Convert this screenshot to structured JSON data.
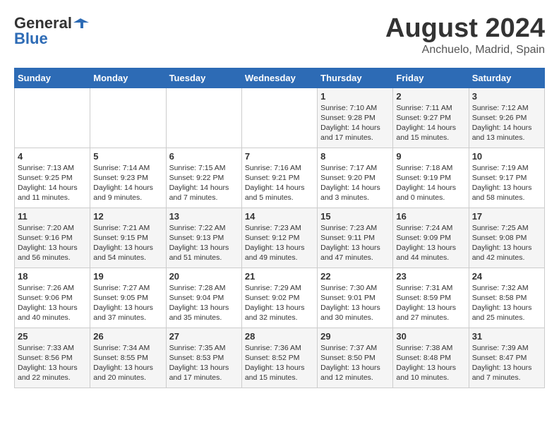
{
  "header": {
    "logo_general": "General",
    "logo_blue": "Blue",
    "month": "August 2024",
    "location": "Anchuelo, Madrid, Spain"
  },
  "weekdays": [
    "Sunday",
    "Monday",
    "Tuesday",
    "Wednesday",
    "Thursday",
    "Friday",
    "Saturday"
  ],
  "weeks": [
    [
      {
        "day": "",
        "sunrise": "",
        "sunset": "",
        "daylight": ""
      },
      {
        "day": "",
        "sunrise": "",
        "sunset": "",
        "daylight": ""
      },
      {
        "day": "",
        "sunrise": "",
        "sunset": "",
        "daylight": ""
      },
      {
        "day": "",
        "sunrise": "",
        "sunset": "",
        "daylight": ""
      },
      {
        "day": "1",
        "sunrise": "Sunrise: 7:10 AM",
        "sunset": "Sunset: 9:28 PM",
        "daylight": "Daylight: 14 hours and 17 minutes."
      },
      {
        "day": "2",
        "sunrise": "Sunrise: 7:11 AM",
        "sunset": "Sunset: 9:27 PM",
        "daylight": "Daylight: 14 hours and 15 minutes."
      },
      {
        "day": "3",
        "sunrise": "Sunrise: 7:12 AM",
        "sunset": "Sunset: 9:26 PM",
        "daylight": "Daylight: 14 hours and 13 minutes."
      }
    ],
    [
      {
        "day": "4",
        "sunrise": "Sunrise: 7:13 AM",
        "sunset": "Sunset: 9:25 PM",
        "daylight": "Daylight: 14 hours and 11 minutes."
      },
      {
        "day": "5",
        "sunrise": "Sunrise: 7:14 AM",
        "sunset": "Sunset: 9:23 PM",
        "daylight": "Daylight: 14 hours and 9 minutes."
      },
      {
        "day": "6",
        "sunrise": "Sunrise: 7:15 AM",
        "sunset": "Sunset: 9:22 PM",
        "daylight": "Daylight: 14 hours and 7 minutes."
      },
      {
        "day": "7",
        "sunrise": "Sunrise: 7:16 AM",
        "sunset": "Sunset: 9:21 PM",
        "daylight": "Daylight: 14 hours and 5 minutes."
      },
      {
        "day": "8",
        "sunrise": "Sunrise: 7:17 AM",
        "sunset": "Sunset: 9:20 PM",
        "daylight": "Daylight: 14 hours and 3 minutes."
      },
      {
        "day": "9",
        "sunrise": "Sunrise: 7:18 AM",
        "sunset": "Sunset: 9:19 PM",
        "daylight": "Daylight: 14 hours and 0 minutes."
      },
      {
        "day": "10",
        "sunrise": "Sunrise: 7:19 AM",
        "sunset": "Sunset: 9:17 PM",
        "daylight": "Daylight: 13 hours and 58 minutes."
      }
    ],
    [
      {
        "day": "11",
        "sunrise": "Sunrise: 7:20 AM",
        "sunset": "Sunset: 9:16 PM",
        "daylight": "Daylight: 13 hours and 56 minutes."
      },
      {
        "day": "12",
        "sunrise": "Sunrise: 7:21 AM",
        "sunset": "Sunset: 9:15 PM",
        "daylight": "Daylight: 13 hours and 54 minutes."
      },
      {
        "day": "13",
        "sunrise": "Sunrise: 7:22 AM",
        "sunset": "Sunset: 9:13 PM",
        "daylight": "Daylight: 13 hours and 51 minutes."
      },
      {
        "day": "14",
        "sunrise": "Sunrise: 7:23 AM",
        "sunset": "Sunset: 9:12 PM",
        "daylight": "Daylight: 13 hours and 49 minutes."
      },
      {
        "day": "15",
        "sunrise": "Sunrise: 7:23 AM",
        "sunset": "Sunset: 9:11 PM",
        "daylight": "Daylight: 13 hours and 47 minutes."
      },
      {
        "day": "16",
        "sunrise": "Sunrise: 7:24 AM",
        "sunset": "Sunset: 9:09 PM",
        "daylight": "Daylight: 13 hours and 44 minutes."
      },
      {
        "day": "17",
        "sunrise": "Sunrise: 7:25 AM",
        "sunset": "Sunset: 9:08 PM",
        "daylight": "Daylight: 13 hours and 42 minutes."
      }
    ],
    [
      {
        "day": "18",
        "sunrise": "Sunrise: 7:26 AM",
        "sunset": "Sunset: 9:06 PM",
        "daylight": "Daylight: 13 hours and 40 minutes."
      },
      {
        "day": "19",
        "sunrise": "Sunrise: 7:27 AM",
        "sunset": "Sunset: 9:05 PM",
        "daylight": "Daylight: 13 hours and 37 minutes."
      },
      {
        "day": "20",
        "sunrise": "Sunrise: 7:28 AM",
        "sunset": "Sunset: 9:04 PM",
        "daylight": "Daylight: 13 hours and 35 minutes."
      },
      {
        "day": "21",
        "sunrise": "Sunrise: 7:29 AM",
        "sunset": "Sunset: 9:02 PM",
        "daylight": "Daylight: 13 hours and 32 minutes."
      },
      {
        "day": "22",
        "sunrise": "Sunrise: 7:30 AM",
        "sunset": "Sunset: 9:01 PM",
        "daylight": "Daylight: 13 hours and 30 minutes."
      },
      {
        "day": "23",
        "sunrise": "Sunrise: 7:31 AM",
        "sunset": "Sunset: 8:59 PM",
        "daylight": "Daylight: 13 hours and 27 minutes."
      },
      {
        "day": "24",
        "sunrise": "Sunrise: 7:32 AM",
        "sunset": "Sunset: 8:58 PM",
        "daylight": "Daylight: 13 hours and 25 minutes."
      }
    ],
    [
      {
        "day": "25",
        "sunrise": "Sunrise: 7:33 AM",
        "sunset": "Sunset: 8:56 PM",
        "daylight": "Daylight: 13 hours and 22 minutes."
      },
      {
        "day": "26",
        "sunrise": "Sunrise: 7:34 AM",
        "sunset": "Sunset: 8:55 PM",
        "daylight": "Daylight: 13 hours and 20 minutes."
      },
      {
        "day": "27",
        "sunrise": "Sunrise: 7:35 AM",
        "sunset": "Sunset: 8:53 PM",
        "daylight": "Daylight: 13 hours and 17 minutes."
      },
      {
        "day": "28",
        "sunrise": "Sunrise: 7:36 AM",
        "sunset": "Sunset: 8:52 PM",
        "daylight": "Daylight: 13 hours and 15 minutes."
      },
      {
        "day": "29",
        "sunrise": "Sunrise: 7:37 AM",
        "sunset": "Sunset: 8:50 PM",
        "daylight": "Daylight: 13 hours and 12 minutes."
      },
      {
        "day": "30",
        "sunrise": "Sunrise: 7:38 AM",
        "sunset": "Sunset: 8:48 PM",
        "daylight": "Daylight: 13 hours and 10 minutes."
      },
      {
        "day": "31",
        "sunrise": "Sunrise: 7:39 AM",
        "sunset": "Sunset: 8:47 PM",
        "daylight": "Daylight: 13 hours and 7 minutes."
      }
    ]
  ]
}
